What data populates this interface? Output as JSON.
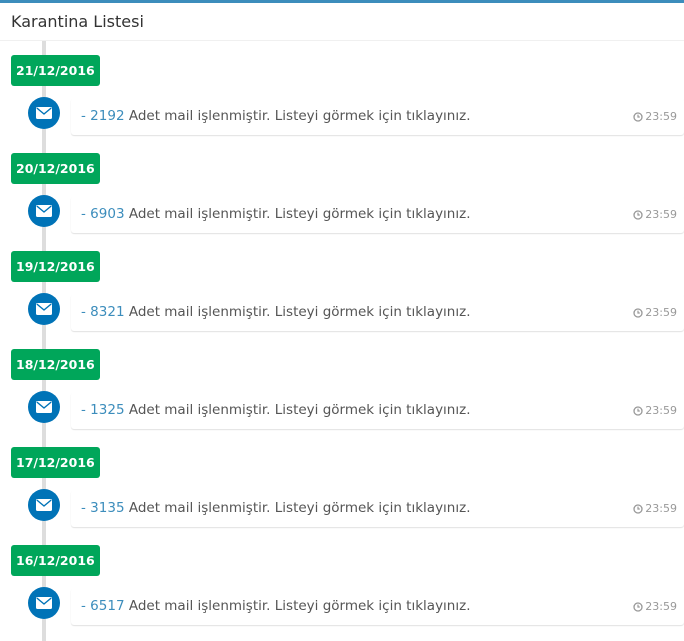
{
  "header": {
    "title": "Karantina Listesi"
  },
  "entries": [
    {
      "date": "21/12/2016",
      "prefix": "- ",
      "count": "2192",
      "message": " Adet mail işlenmiştir. Listeyi görmek için tıklayınız.",
      "time": "23:59",
      "icon": "envelope-icon"
    },
    {
      "date": "20/12/2016",
      "prefix": "- ",
      "count": "6903",
      "message": " Adet mail işlenmiştir. Listeyi görmek için tıklayınız.",
      "time": "23:59",
      "icon": "envelope-icon"
    },
    {
      "date": "19/12/2016",
      "prefix": "- ",
      "count": "8321",
      "message": " Adet mail işlenmiştir. Listeyi görmek için tıklayınız.",
      "time": "23:59",
      "icon": "envelope-icon"
    },
    {
      "date": "18/12/2016",
      "prefix": "- ",
      "count": "1325",
      "message": " Adet mail işlenmiştir. Listeyi görmek için tıklayınız.",
      "time": "23:59",
      "icon": "envelope-icon"
    },
    {
      "date": "17/12/2016",
      "prefix": "- ",
      "count": "3135",
      "message": " Adet mail işlenmiştir. Listeyi görmek için tıklayınız.",
      "time": "23:59",
      "icon": "envelope-icon"
    },
    {
      "date": "16/12/2016",
      "prefix": "- ",
      "count": "6517",
      "message": " Adet mail işlenmiştir. Listeyi görmek için tıklayınız.",
      "time": "23:59",
      "icon": "envelope-icon"
    }
  ],
  "colors": {
    "label_bg": "#00a65a",
    "icon_bg": "#0073b7",
    "accent": "#3c8dbc"
  }
}
